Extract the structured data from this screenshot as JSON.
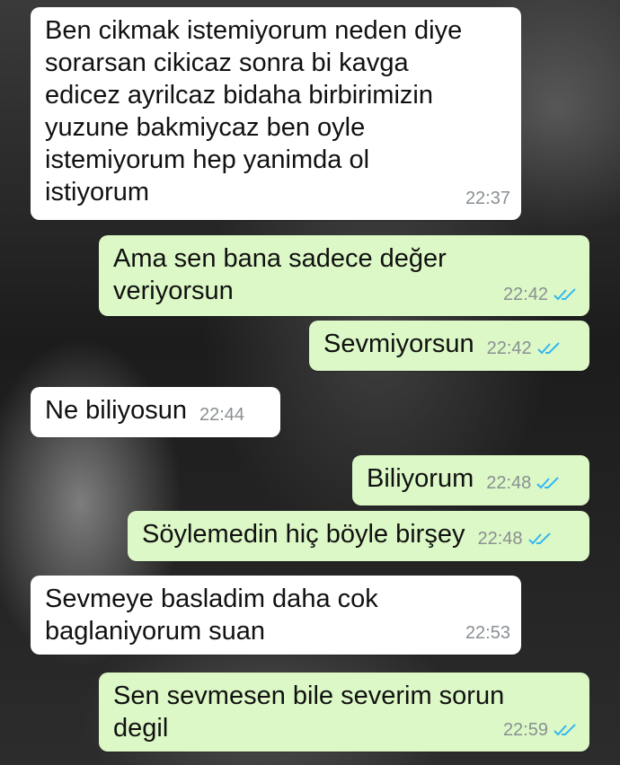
{
  "colors": {
    "incoming": "#ffffff",
    "outgoing": "#dcf8c6",
    "read_ticks": "#34b7f1",
    "timestamp": "#8a8f93"
  },
  "messages": [
    {
      "direction": "in",
      "text": "Ben cikmak istemiyorum neden diye\nsorarsan cikicaz sonra bi kavga\nedicez ayrilcaz bidaha birbirimizin\nyuzune bakmiycaz ben oyle\nistemiyorum hep yanimda ol\nistiyorum",
      "time": "22:37"
    },
    {
      "direction": "out",
      "text": "Ama sen bana sadece değer\nveriyorsun",
      "time": "22:42",
      "status": "read"
    },
    {
      "direction": "out",
      "text": "Sevmiyorsun",
      "time": "22:42",
      "status": "read"
    },
    {
      "direction": "in",
      "text": "Ne biliyosun",
      "time": "22:44"
    },
    {
      "direction": "out",
      "text": "Biliyorum",
      "time": "22:48",
      "status": "read"
    },
    {
      "direction": "out",
      "text": "Söylemedin hiç böyle birşey",
      "time": "22:48",
      "status": "read"
    },
    {
      "direction": "in",
      "text": "Sevmeye basladim daha cok\nbaglaniyorum suan",
      "time": "22:53"
    },
    {
      "direction": "out",
      "text": "Sen sevmesen bile severim sorun\ndegil",
      "time": "22:59",
      "status": "read"
    }
  ]
}
